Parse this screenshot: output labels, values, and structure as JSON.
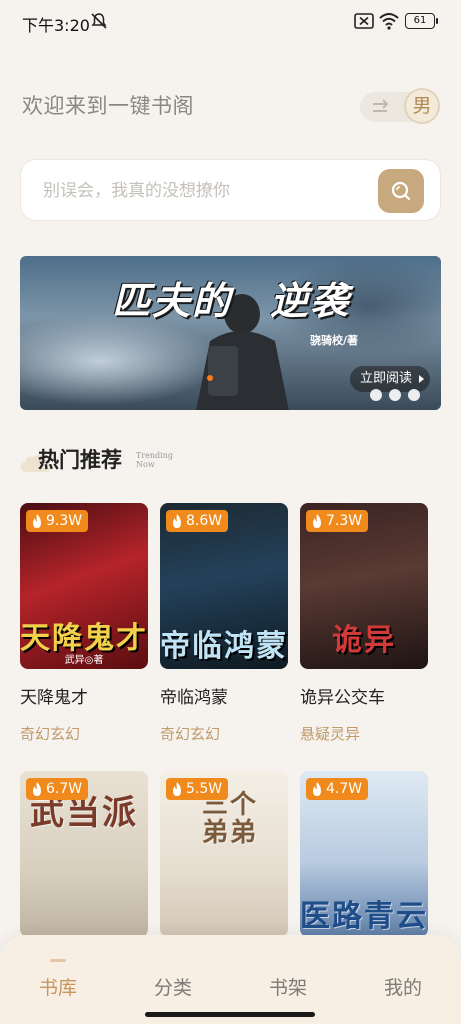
{
  "status_bar": {
    "time": "下午3:20",
    "battery": "61"
  },
  "header": {
    "welcome": "欢迎来到一键书阁",
    "gender": "男"
  },
  "search": {
    "placeholder": "别误会，我真的没想撩你"
  },
  "banner": {
    "title_part1": "匹夫的",
    "title_part2": "逆袭",
    "author": "骁骑校/著",
    "read_label": "立即阅读",
    "dot_count": 3
  },
  "section": {
    "title": "热门推荐",
    "subtitle": "Trending Now"
  },
  "books": [
    {
      "heat": "9.3W",
      "name": "天降鬼才",
      "genre": "奇幻玄幻",
      "cover_text": "天降鬼才",
      "cover_author": "武异◎著",
      "colors": [
        "#b5242a",
        "#f2d04a"
      ]
    },
    {
      "heat": "8.6W",
      "name": "帝临鸿蒙",
      "genre": "奇幻玄幻",
      "cover_text": "帝临鸿蒙",
      "cover_author": "",
      "colors": [
        "#24415a",
        "#bfe2f5"
      ]
    },
    {
      "heat": "7.3W",
      "name": "诡异公交车",
      "genre": "悬疑灵异",
      "cover_text": "诡异",
      "cover_author": "",
      "colors": [
        "#5a3a34",
        "#d23a3a"
      ]
    },
    {
      "heat": "6.7W",
      "name": "",
      "genre": "",
      "cover_text": "武当派",
      "cover_author": "",
      "colors": [
        "#d8cfbf",
        "#7a3b2a"
      ]
    },
    {
      "heat": "5.5W",
      "name": "",
      "genre": "",
      "cover_text": "三个弟弟",
      "cover_author": "",
      "colors": [
        "#e6ddd0",
        "#7a5a3a"
      ]
    },
    {
      "heat": "4.7W",
      "name": "",
      "genre": "",
      "cover_text": "医路青云",
      "cover_author": "",
      "colors": [
        "#b8cbe0",
        "#1e4d8a"
      ]
    }
  ],
  "nav": {
    "items": [
      {
        "label": "书库",
        "active": true
      },
      {
        "label": "分类",
        "active": false
      },
      {
        "label": "书架",
        "active": false
      },
      {
        "label": "我的",
        "active": false
      }
    ]
  },
  "colors": {
    "accent": "#c8a97f",
    "heat_badge": "#f08a1c",
    "genre": "#c09a6b",
    "nav_active": "#c8955c"
  }
}
